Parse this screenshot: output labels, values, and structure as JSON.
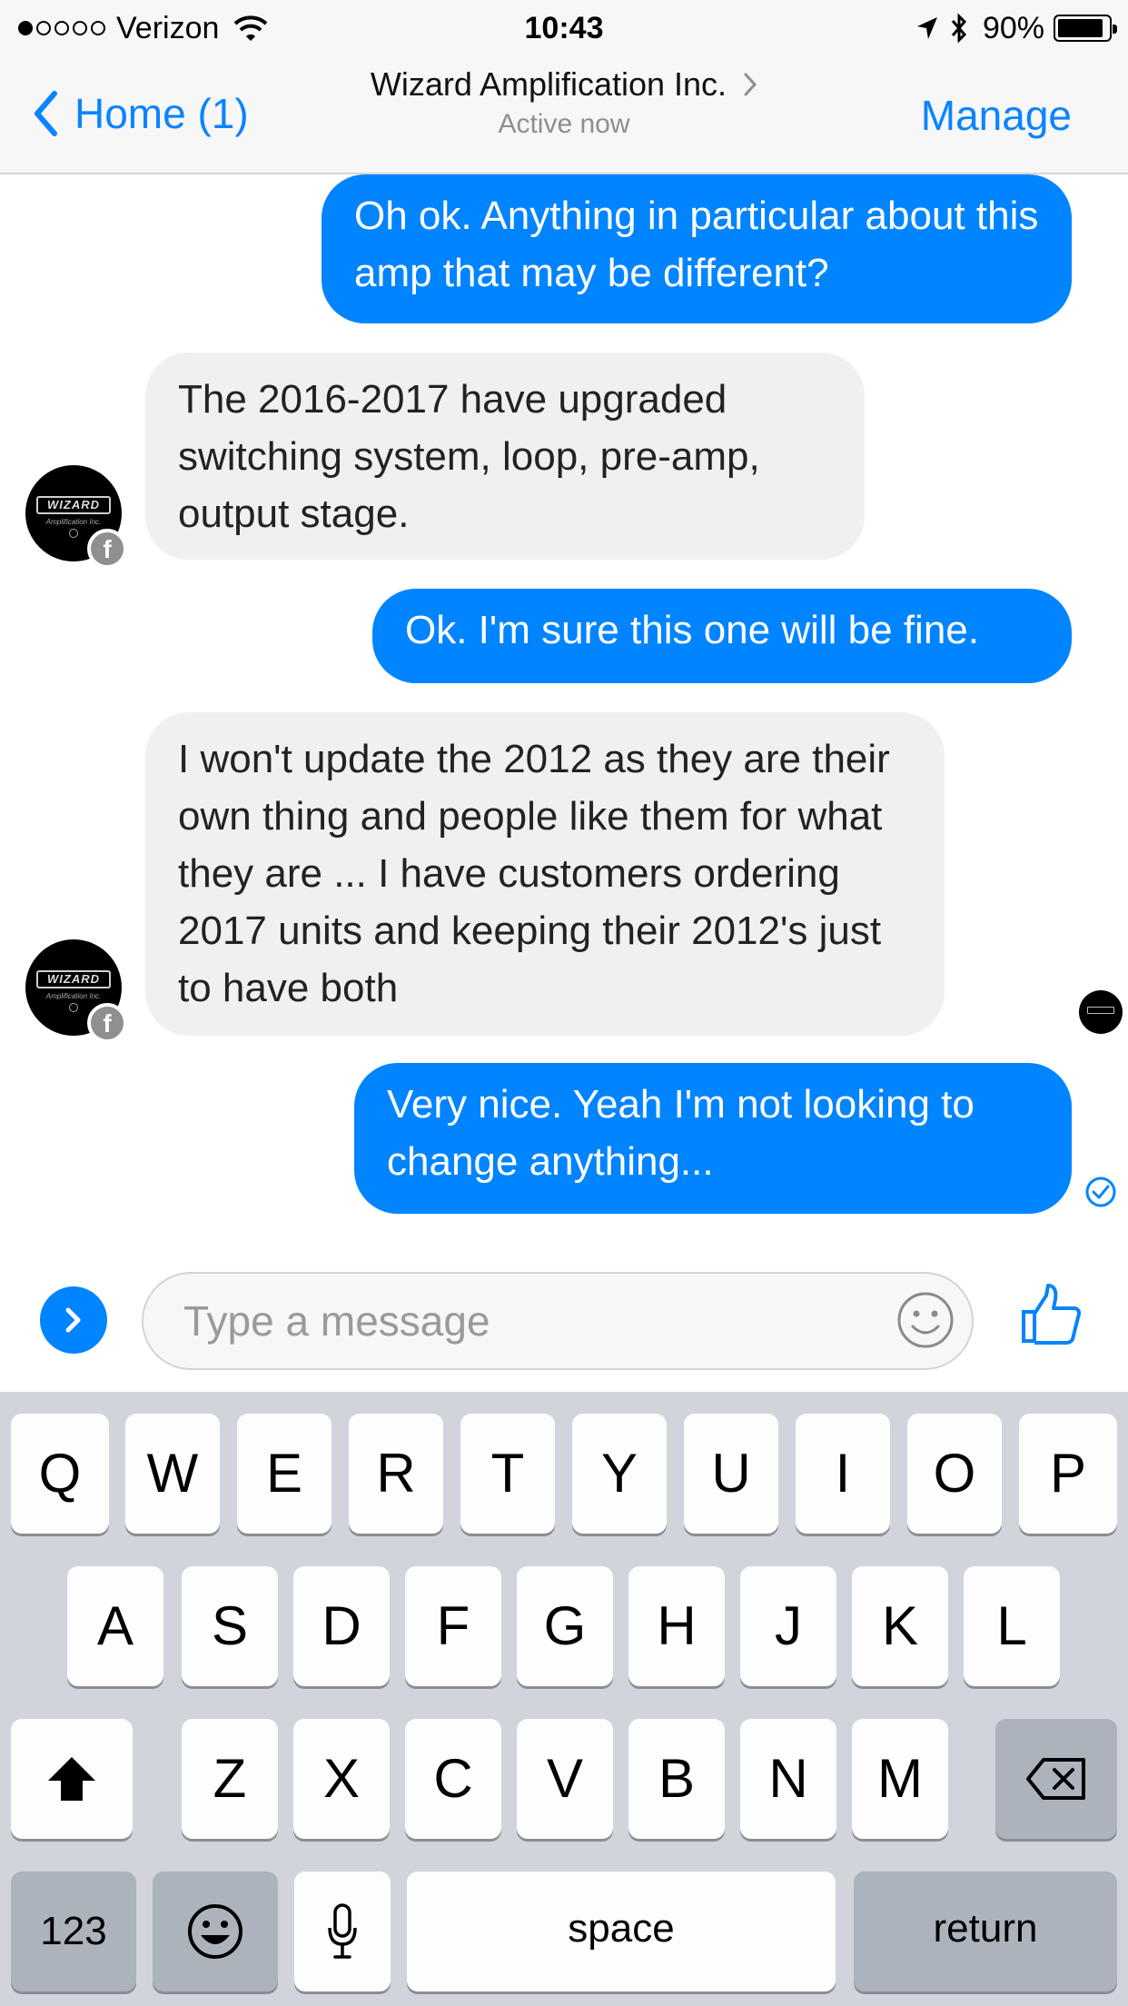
{
  "status_bar": {
    "carrier": "Verizon",
    "signal_bars_filled": 1,
    "signal_bars_total": 5,
    "time": "10:43",
    "battery_percent": "90%",
    "battery_level": 0.9
  },
  "nav": {
    "back_label": "Home (1)",
    "title": "Wizard Amplification Inc.",
    "subtitle": "Active now",
    "manage_label": "Manage"
  },
  "messages": [
    {
      "direction": "outgoing",
      "lines": [
        "Oh ok. Anything in particular about",
        "this amp that may be different?"
      ]
    },
    {
      "direction": "incoming",
      "lines": [
        "The 2016-2017 have upgraded",
        "switching system, loop, pre-amp,",
        "output stage."
      ]
    },
    {
      "direction": "outgoing",
      "lines": [
        "Ok. I'm sure this one will be fine."
      ]
    },
    {
      "direction": "incoming",
      "lines": [
        "I won't update the 2012 as they are",
        "their own thing and people like them",
        "for what they are ... I have customers",
        "ordering 2017 units and keeping their",
        "2012's just to have both"
      ]
    },
    {
      "direction": "outgoing",
      "lines": [
        "Very nice. Yeah I'm not looking to",
        "change anything..."
      ]
    }
  ],
  "avatar": {
    "logo_text": "WIZARD",
    "logo_sub": "Amplification Inc.",
    "badge": "f"
  },
  "composer": {
    "placeholder": "Type a message"
  },
  "keyboard": {
    "row1": [
      "Q",
      "W",
      "E",
      "R",
      "T",
      "Y",
      "U",
      "I",
      "O",
      "P"
    ],
    "row2": [
      "A",
      "S",
      "D",
      "F",
      "G",
      "H",
      "J",
      "K",
      "L"
    ],
    "row3": [
      "Z",
      "X",
      "C",
      "V",
      "B",
      "N",
      "M"
    ],
    "numbers_label": "123",
    "space_label": "space",
    "return_label": "return"
  },
  "colors": {
    "accent": "#0084ff",
    "nav_link": "#0a84ff",
    "incoming_bubble": "#f1f0f0",
    "keyboard_bg": "#d1d5db"
  },
  "icons": [
    "wifi-icon",
    "location-icon",
    "bluetooth-icon",
    "battery-icon",
    "back-chevron-icon",
    "chevron-right-icon",
    "facebook-badge-icon",
    "delivered-check-icon",
    "expand-icon",
    "emoji-icon",
    "thumbs-up-icon",
    "shift-icon",
    "backspace-icon",
    "emoji-keyboard-icon",
    "microphone-icon"
  ]
}
